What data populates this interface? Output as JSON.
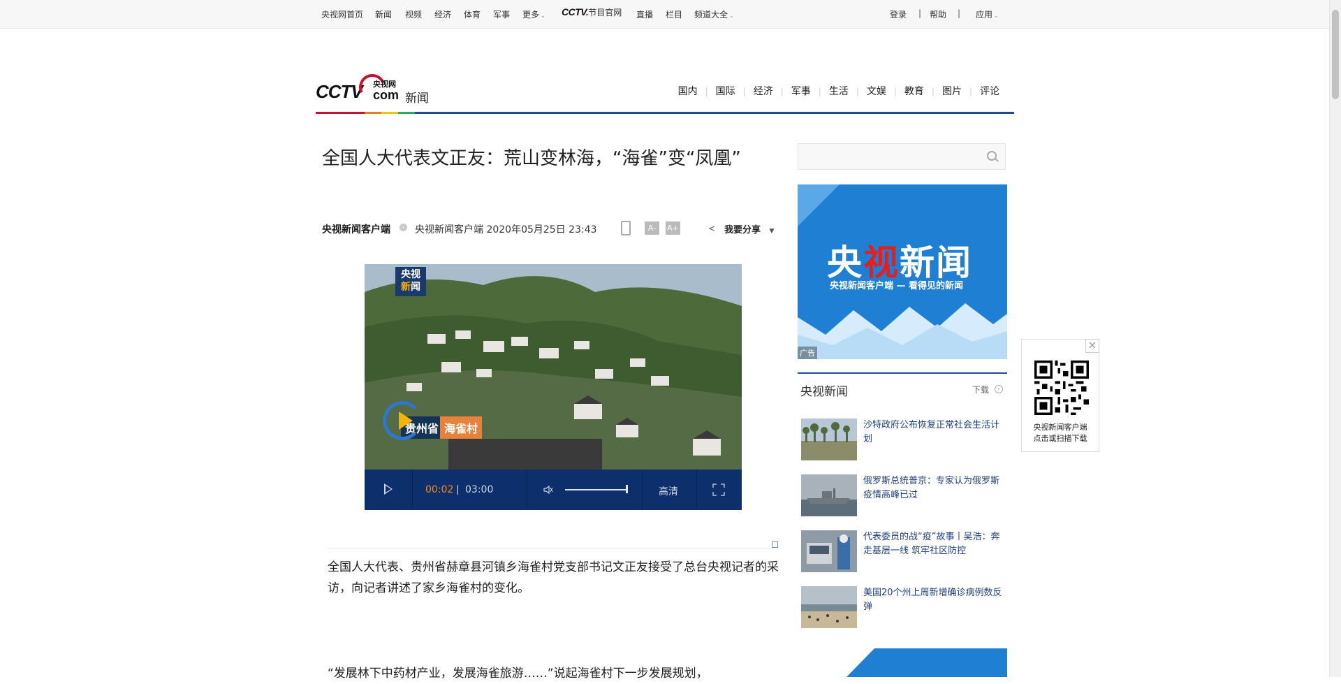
{
  "topnav": {
    "left": [
      "央视网首页",
      "新闻",
      "视频",
      "经济",
      "体育",
      "军事",
      "更多"
    ],
    "cctv_brand": "CCTV",
    "cctv_dot": ".",
    "cctv_suffix": "节目官网",
    "mid": [
      "直播",
      "栏目",
      "频道大全"
    ],
    "right": [
      "登录",
      "帮助",
      "应用"
    ],
    "separator": "|"
  },
  "header": {
    "logo_cctv": "CCTV",
    "logo_yangshi": "央视网",
    "logo_com": "com",
    "logo_news": "新闻",
    "nav": [
      "国内",
      "国际",
      "经济",
      "军事",
      "生活",
      "文娱",
      "教育",
      "图片",
      "评论"
    ],
    "rainbow_colors": [
      "#c8102e",
      "#e67e22",
      "#f1c40f",
      "#27ae60",
      "#1e88e5",
      "#8e44ad"
    ]
  },
  "article": {
    "title": "全国人大代表文正友：荒山变林海，“海雀”变“凤凰”",
    "source": "央视新闻客户端",
    "from_label": "央视新闻客户端 2020年05月25日 23:43",
    "font_minus": "A-",
    "font_plus": "A+",
    "share_label": "我要分享",
    "para1": "全国人大代表、贵州省赫章县河镇乡海雀村党支部书记文正友接受了总台央视记者的采访，向记者讲述了家乡海雀村的变化。",
    "para2": "“发展林下中药材产业，发展海雀旅游……”说起海雀村下一步发展规划，"
  },
  "video": {
    "watermark_line1": "央视",
    "watermark_line2_a": "新",
    "watermark_line2_b": "闻",
    "caption_province": "贵州省",
    "caption_village": "海雀村",
    "current_time": "00:02",
    "time_sep": "|",
    "total_time": "03:00",
    "quality": "高清",
    "volume": 0.95,
    "progress": 0.011
  },
  "sidebar": {
    "search_placeholder": "",
    "ad1_title_a": "央",
    "ad1_title_b": "视",
    "ad1_title_c": "新闻",
    "ad1_sub": "央视新闻客户端 — 看得见的新闻",
    "ad_tag": "广告",
    "section_title": "央视新闻",
    "download": "下载",
    "news": [
      {
        "title": "沙特政府公布恢复正常社会生活计划"
      },
      {
        "title": "俄罗斯总统普京：专家认为俄罗斯疫情高峰已过"
      },
      {
        "title": "代表委员的战“疫”故事丨吴浩：奔走基层一线 筑牢社区防控"
      },
      {
        "title": "美国20个州上周新增确诊病例数反弹"
      }
    ]
  },
  "qr": {
    "close": "×",
    "line1": "央视新闻客户端",
    "line2": "点击或扫描下载"
  }
}
